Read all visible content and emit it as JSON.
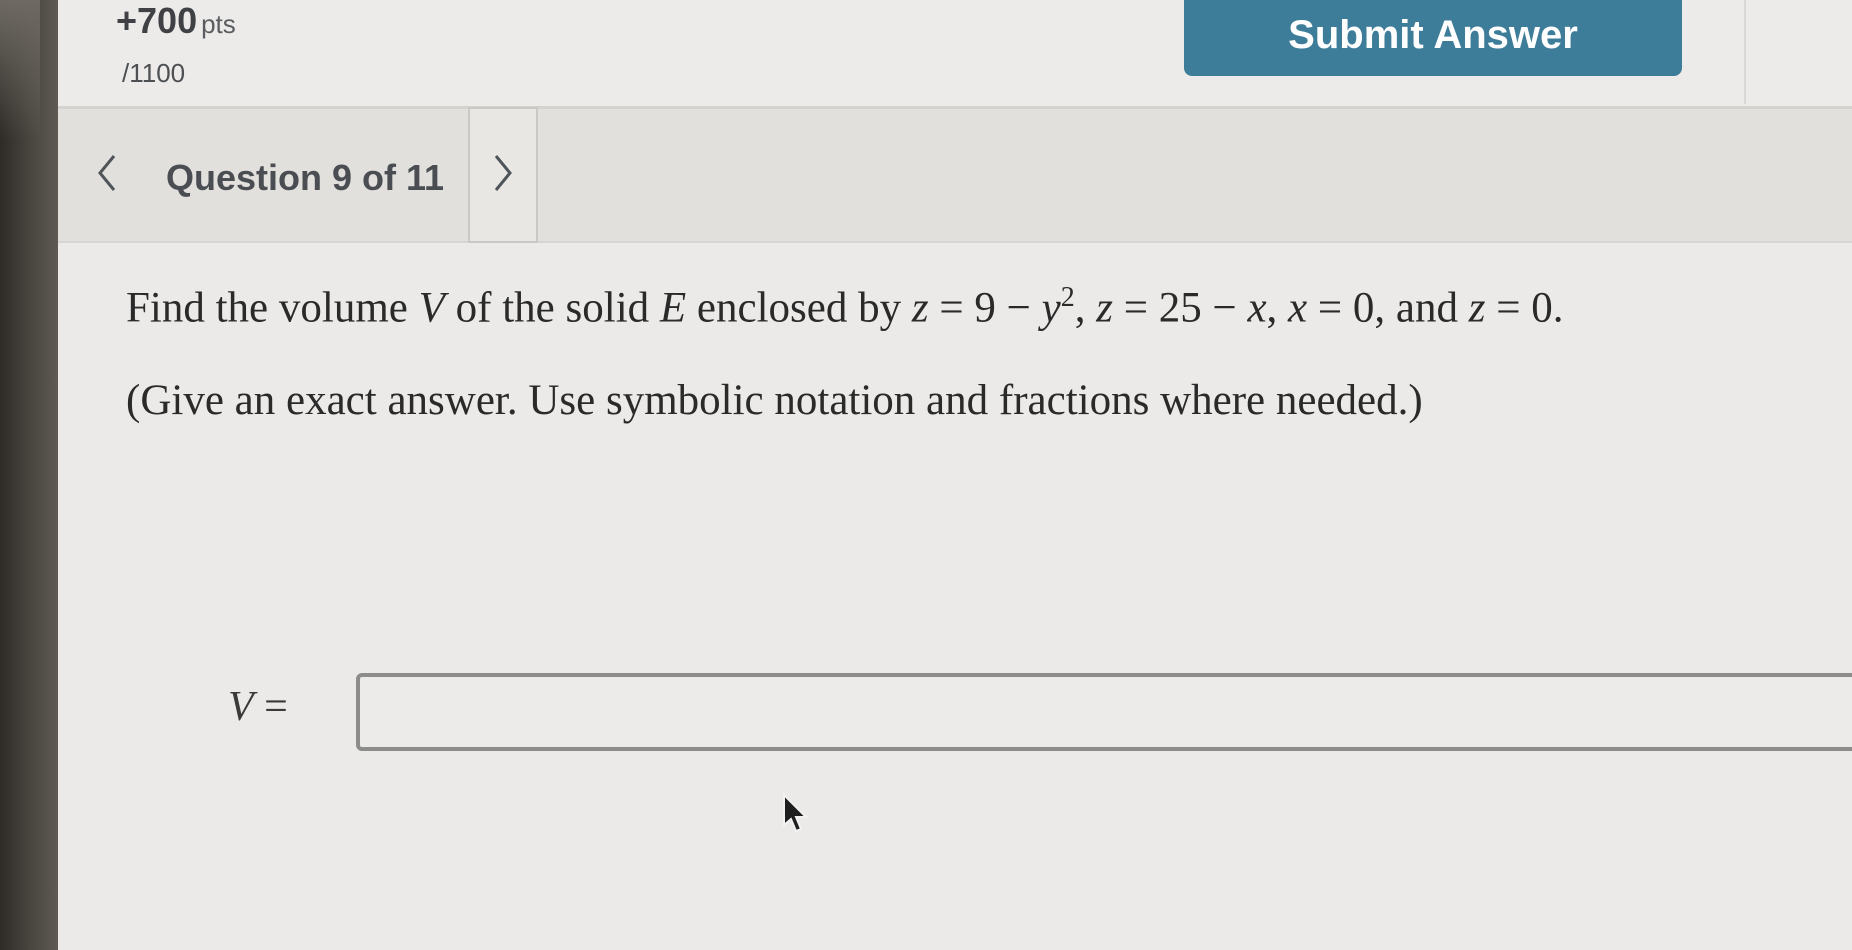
{
  "header": {
    "points_value": "+700",
    "points_unit": "pts",
    "points_total": "/1100",
    "submit_label": "Submit Answer"
  },
  "nav": {
    "question_counter": "Question 9 of 11",
    "prev_icon": "chevron-left-icon",
    "next_icon": "chevron-right-icon"
  },
  "question": {
    "intro": "Find the volume ",
    "var_v": "V",
    "of_solid": " of the solid ",
    "var_e": "E",
    "enclosed_by": " enclosed by ",
    "eq1_a": "z",
    "eq1_b": " = 9 − ",
    "eq1_c": "y",
    "eq1_exp": "2",
    "sep1": ", ",
    "eq2_a": "z",
    "eq2_b": " = 25 − ",
    "eq2_c": "x",
    "sep2": ", ",
    "eq3_a": "x",
    "eq3_b": " = 0",
    "and": ", and ",
    "eq4_a": "z",
    "eq4_b": " = 0.",
    "instructions": "(Give an exact answer. Use symbolic notation and fractions where needed.)"
  },
  "answer": {
    "label_var": "V",
    "label_eq": " =",
    "value": ""
  },
  "colors": {
    "submit_bg": "#3e7d9a",
    "background": "#e9e8e6"
  }
}
